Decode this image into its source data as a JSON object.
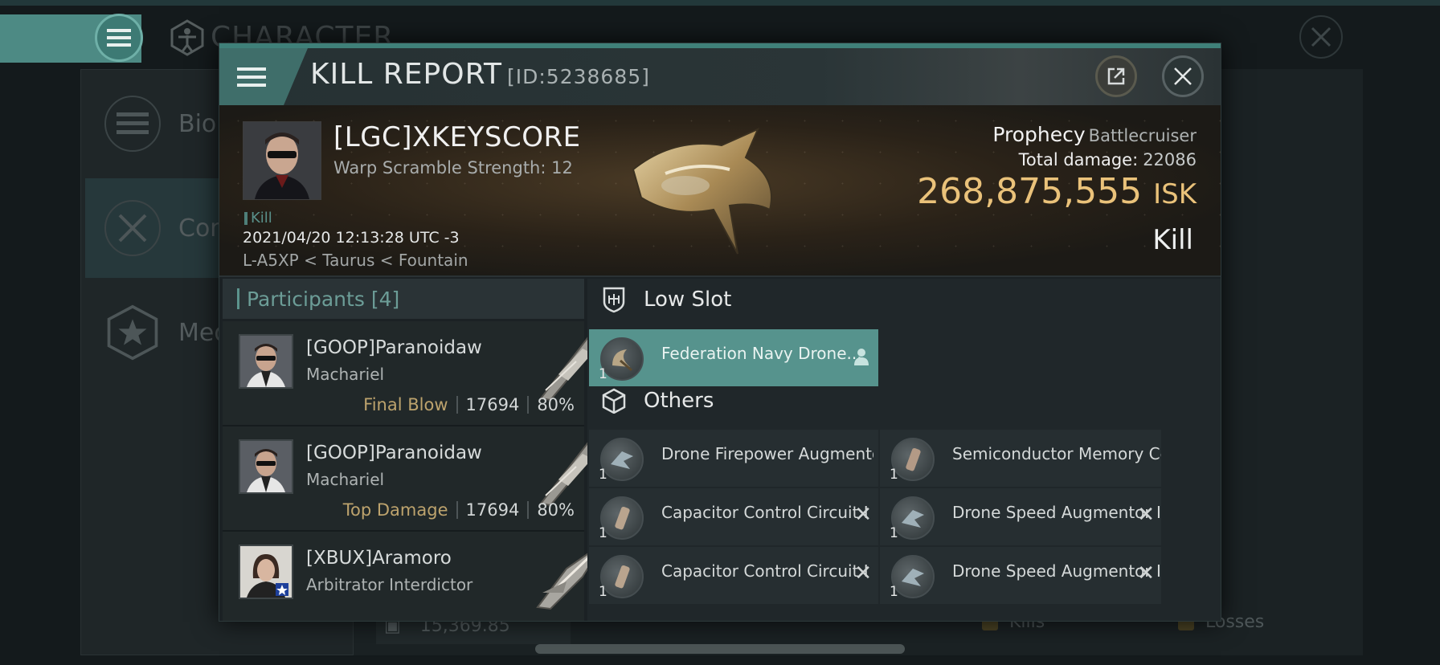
{
  "background": {
    "title": "CHARACTER",
    "nav": [
      {
        "label": "Bio"
      },
      {
        "label": "Con"
      },
      {
        "label": "Med"
      }
    ],
    "bottom_value": "15,369.85",
    "kills_label": "Kills",
    "losses_label": "Losses"
  },
  "header": {
    "title": "KILL REPORT",
    "id": "[ID:5238685]"
  },
  "victim": {
    "name": "[LGC]XKEYSCORE",
    "warp": "Warp Scramble Strength: 12",
    "kill_tag": "Kill",
    "datetime": "2021/04/20 12:13:28 UTC -3",
    "location": "L-A5XP < Taurus < Fountain",
    "ship": "Prophecy",
    "ship_class": "Battlecruiser",
    "damage_label": "Total damage:",
    "damage": "22086",
    "isk": "268,875,555",
    "isk_unit": "ISK",
    "type": "Kill"
  },
  "participants": {
    "label": "Participants",
    "count": "[4]",
    "rows": [
      {
        "name": "[GOOP]Paranoidaw",
        "ship": "Machariel",
        "tag": "Final Blow",
        "damage": "17694",
        "pct": "80%"
      },
      {
        "name": "[GOOP]Paranoidaw",
        "ship": "Machariel",
        "tag": "Top Damage",
        "damage": "17694",
        "pct": "80%"
      },
      {
        "name": "[XBUX]Aramoro",
        "ship": "Arbitrator Interdictor",
        "tag": "",
        "damage": "",
        "pct": ""
      }
    ]
  },
  "items": {
    "low_slot_label": "Low Slot",
    "others_label": "Others",
    "low_slot": [
      {
        "name": "Federation Navy Drone...",
        "qty": "1"
      }
    ],
    "others": [
      {
        "name": "Drone Firepower Augmento...",
        "qty": "1"
      },
      {
        "name": "Semiconductor Memory Cel...",
        "qty": "1"
      },
      {
        "name": "Capacitor Control Circuit I",
        "qty": "1"
      },
      {
        "name": "Drone Speed Augmentor II",
        "qty": "1"
      },
      {
        "name": "Capacitor Control Circuit I",
        "qty": "1"
      },
      {
        "name": "Drone Speed Augmentor II",
        "qty": "1"
      }
    ]
  },
  "colors": {
    "accent": "#56938d",
    "isk": "#eac27a",
    "tag": "#bda36d"
  }
}
